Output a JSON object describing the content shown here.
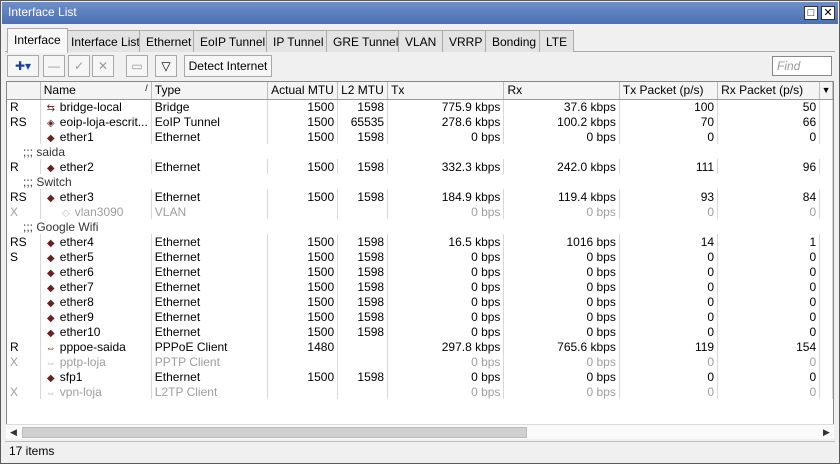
{
  "window": {
    "title": "Interface List"
  },
  "tabs": [
    "Interface",
    "Interface List",
    "Ethernet",
    "EoIP Tunnel",
    "IP Tunnel",
    "GRE Tunnel",
    "VLAN",
    "VRRP",
    "Bonding",
    "LTE"
  ],
  "toolbar": {
    "detect_label": "Detect Internet",
    "find_placeholder": "Find"
  },
  "columns": [
    "",
    "Name",
    "Type",
    "Actual MTU",
    "L2 MTU",
    "Tx",
    "Rx",
    "Tx Packet (p/s)",
    "Rx Packet (p/s)"
  ],
  "rows": [
    {
      "flag": "R",
      "name": "bridge-local",
      "type": "Bridge",
      "mtu": "1500",
      "l2": "1598",
      "tx": "775.9 kbps",
      "rx": "37.6 kbps",
      "txp": "100",
      "rxp": "50",
      "icon": "bridge-icon"
    },
    {
      "flag": "RS",
      "name": "eoip-loja-escrit...",
      "type": "EoIP Tunnel",
      "mtu": "1500",
      "l2": "65535",
      "tx": "278.6 kbps",
      "rx": "100.2 kbps",
      "txp": "70",
      "rxp": "66",
      "icon": "tunnel-icon"
    },
    {
      "flag": "",
      "name": "ether1",
      "type": "Ethernet",
      "mtu": "1500",
      "l2": "1598",
      "tx": "0 bps",
      "rx": "0 bps",
      "txp": "0",
      "rxp": "0",
      "icon": "ethernet-icon"
    },
    {
      "comment": ";;; saida"
    },
    {
      "flag": "R",
      "name": "ether2",
      "type": "Ethernet",
      "mtu": "1500",
      "l2": "1598",
      "tx": "332.3 kbps",
      "rx": "242.0 kbps",
      "txp": "111",
      "rxp": "96",
      "icon": "ethernet-icon"
    },
    {
      "comment": ";;; Switch"
    },
    {
      "flag": "RS",
      "name": "ether3",
      "type": "Ethernet",
      "mtu": "1500",
      "l2": "1598",
      "tx": "184.9 kbps",
      "rx": "119.4 kbps",
      "txp": "93",
      "rxp": "84",
      "icon": "ethernet-icon"
    },
    {
      "flag": "X",
      "name": "vlan3090",
      "type": "VLAN",
      "mtu": "",
      "l2": "",
      "tx": "0 bps",
      "rx": "0 bps",
      "txp": "0",
      "rxp": "0",
      "icon": "vlan-icon",
      "disabled": true,
      "indent": true
    },
    {
      "comment": ";;; Google Wifi"
    },
    {
      "flag": "RS",
      "name": "ether4",
      "type": "Ethernet",
      "mtu": "1500",
      "l2": "1598",
      "tx": "16.5 kbps",
      "rx": "1016 bps",
      "txp": "14",
      "rxp": "1",
      "icon": "ethernet-icon"
    },
    {
      "flag": "S",
      "name": "ether5",
      "type": "Ethernet",
      "mtu": "1500",
      "l2": "1598",
      "tx": "0 bps",
      "rx": "0 bps",
      "txp": "0",
      "rxp": "0",
      "icon": "ethernet-icon"
    },
    {
      "flag": "",
      "name": "ether6",
      "type": "Ethernet",
      "mtu": "1500",
      "l2": "1598",
      "tx": "0 bps",
      "rx": "0 bps",
      "txp": "0",
      "rxp": "0",
      "icon": "ethernet-icon"
    },
    {
      "flag": "",
      "name": "ether7",
      "type": "Ethernet",
      "mtu": "1500",
      "l2": "1598",
      "tx": "0 bps",
      "rx": "0 bps",
      "txp": "0",
      "rxp": "0",
      "icon": "ethernet-icon"
    },
    {
      "flag": "",
      "name": "ether8",
      "type": "Ethernet",
      "mtu": "1500",
      "l2": "1598",
      "tx": "0 bps",
      "rx": "0 bps",
      "txp": "0",
      "rxp": "0",
      "icon": "ethernet-icon"
    },
    {
      "flag": "",
      "name": "ether9",
      "type": "Ethernet",
      "mtu": "1500",
      "l2": "1598",
      "tx": "0 bps",
      "rx": "0 bps",
      "txp": "0",
      "rxp": "0",
      "icon": "ethernet-icon"
    },
    {
      "flag": "",
      "name": "ether10",
      "type": "Ethernet",
      "mtu": "1500",
      "l2": "1598",
      "tx": "0 bps",
      "rx": "0 bps",
      "txp": "0",
      "rxp": "0",
      "icon": "ethernet-icon"
    },
    {
      "flag": "R",
      "name": "pppoe-saida",
      "type": "PPPoE Client",
      "mtu": "1480",
      "l2": "",
      "tx": "297.8 kbps",
      "rx": "765.6 kbps",
      "txp": "119",
      "rxp": "154",
      "icon": "ppp-icon"
    },
    {
      "flag": "X",
      "name": "pptp-loja",
      "type": "PPTP Client",
      "mtu": "",
      "l2": "",
      "tx": "0 bps",
      "rx": "0 bps",
      "txp": "0",
      "rxp": "0",
      "icon": "ppp-icon",
      "disabled": true
    },
    {
      "flag": "",
      "name": "sfp1",
      "type": "Ethernet",
      "mtu": "1500",
      "l2": "1598",
      "tx": "0 bps",
      "rx": "0 bps",
      "txp": "0",
      "rxp": "0",
      "icon": "ethernet-icon"
    },
    {
      "flag": "X",
      "name": "vpn-loja",
      "type": "L2TP Client",
      "mtu": "",
      "l2": "",
      "tx": "0 bps",
      "rx": "0 bps",
      "txp": "0",
      "rxp": "0",
      "icon": "ppp-icon",
      "disabled": true
    }
  ],
  "status": {
    "items": "17 items"
  }
}
